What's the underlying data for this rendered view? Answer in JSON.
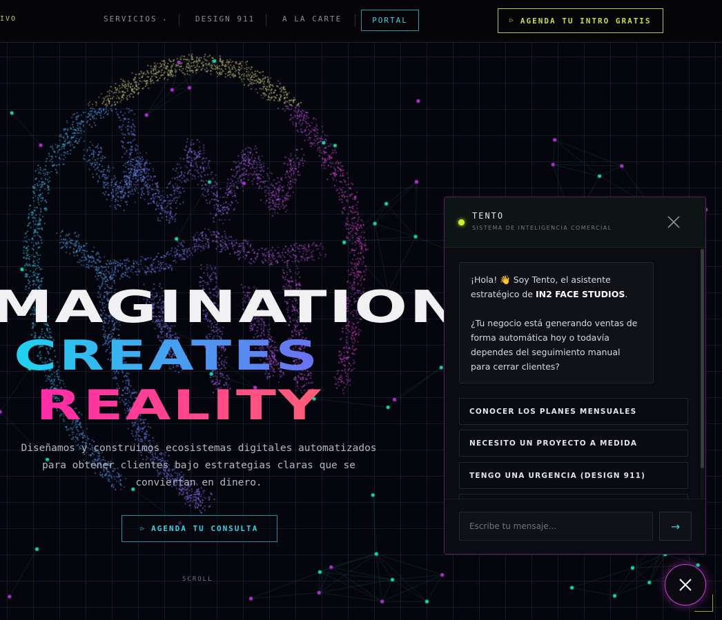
{
  "nav": {
    "cut_label": "IVO",
    "items": [
      {
        "label": "SERVICIOS",
        "suffix": "▾"
      },
      {
        "label": "DESIGN 911"
      },
      {
        "label": "A LA CARTE"
      }
    ],
    "portal_label": "PORTAL",
    "cta_icon": "▷",
    "cta_label": "AGENDA TU INTRO GRATIS"
  },
  "hero": {
    "line1": "MAGINATION",
    "line2": "CREATES",
    "line3": "REALITY",
    "subtitle": "Diseñamos y construimos ecosistemas digitales automatizados para obtener clientes bajo estrategias claras que se conviertan en dinero.",
    "cta_icon": "▷",
    "cta_label": "AGENDA TU CONSULTA",
    "scroll_label": "SCROLL"
  },
  "chat": {
    "title": "TENTO",
    "subtitle": "SISTEMA DE INTELIGENCIA COMERCIAL",
    "message": {
      "greeting_pre": "¡Hola! 👋 Soy Tento, el asistente estratégico de ",
      "brand": "IN2 FACE STUDIOS",
      "greeting_post": ".",
      "question": "¿Tu negocio está generando ventas de forma automática hoy o todavía dependes del seguimiento manual para cerrar clientes?"
    },
    "options": [
      "CONOCER LOS PLANES MENSUALES",
      "NECESITO UN PROYECTO A MEDIDA",
      "TENGO UNA URGENCIA (DESIGN 911)"
    ],
    "input_placeholder": "Escribe tu mensaje...",
    "send_icon": "→"
  },
  "colors": {
    "accent_lime": "#c9dc45",
    "accent_cyan": "#3fd0e6",
    "accent_magenta": "#d33ad8"
  }
}
